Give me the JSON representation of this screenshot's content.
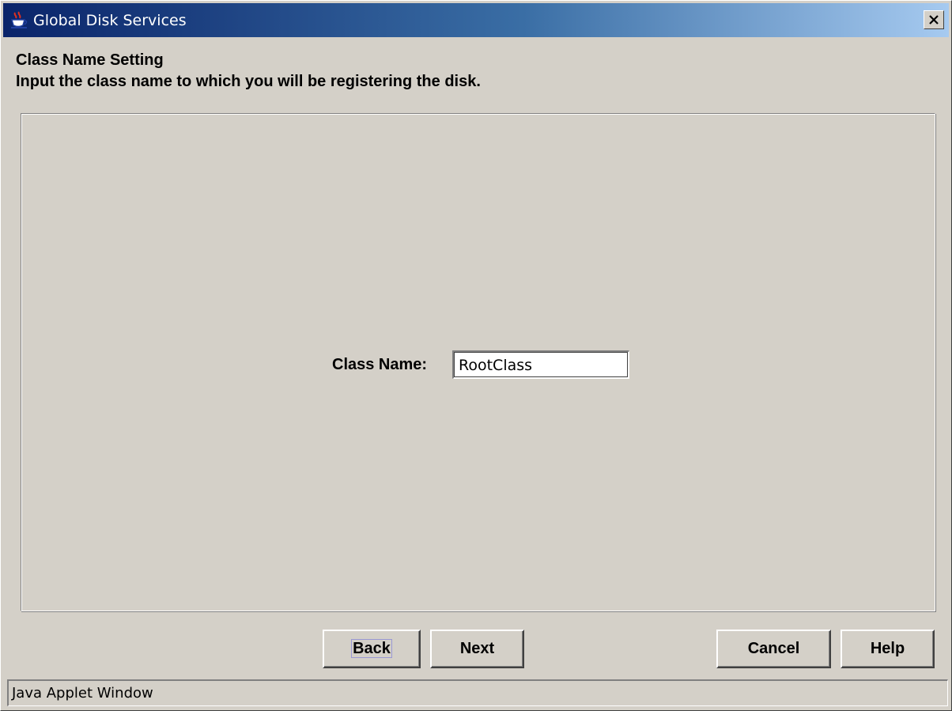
{
  "window": {
    "title": "Global Disk Services",
    "icon": "java-coffee-cup-icon",
    "close_icon": "close-icon",
    "titlebar_colors": [
      "#0a246a",
      "#3a6ea5",
      "#a6caf0"
    ]
  },
  "header": {
    "title": "Class Name Setting",
    "instruction": "Input the class name to which you will be registering the disk."
  },
  "form": {
    "class_name_label": "Class Name:",
    "class_name_value": "RootClass"
  },
  "buttons": {
    "back": "Back",
    "next": "Next",
    "cancel": "Cancel",
    "help": "Help"
  },
  "status": {
    "text": "Java Applet Window"
  }
}
